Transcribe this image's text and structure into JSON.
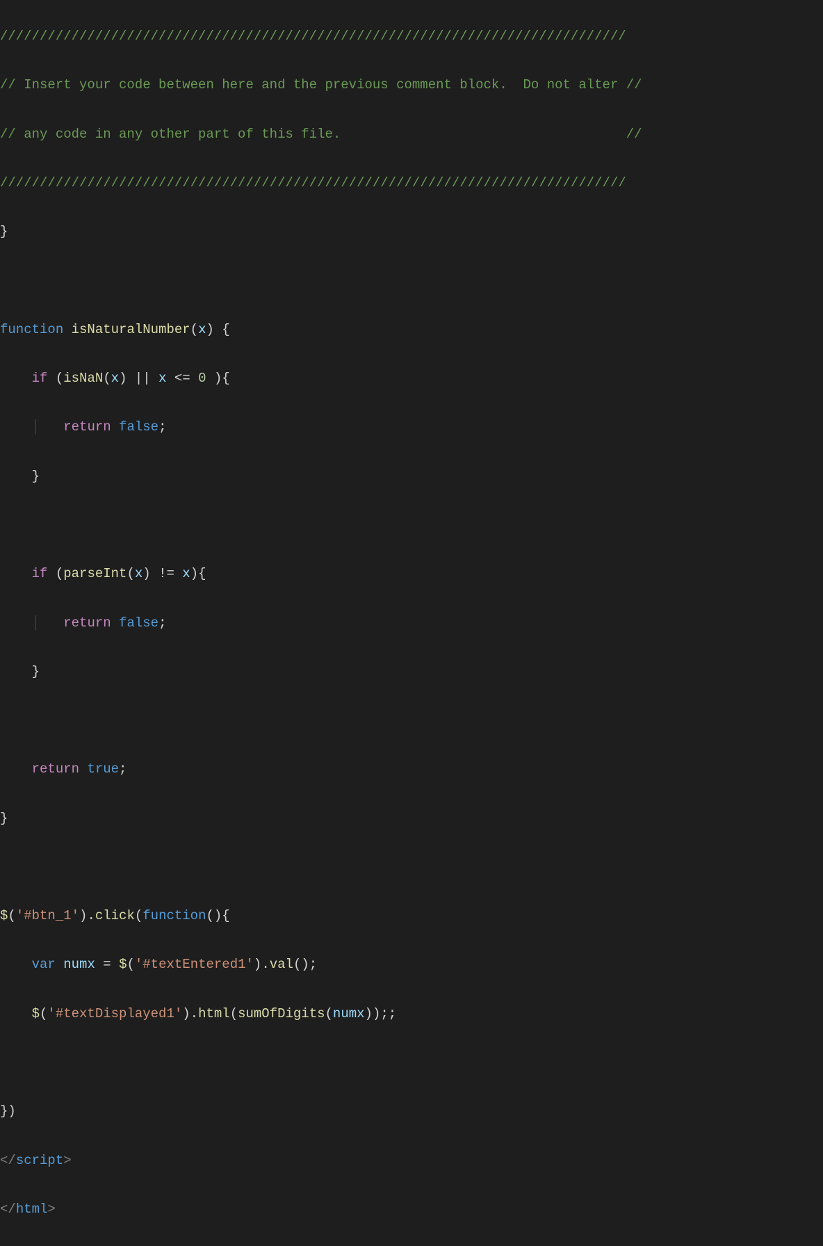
{
  "code": {
    "comment_bar": "///////////////////////////////////////////////////////////////////////////////",
    "comment_line1": "// Insert your code between here and the previous comment block.  Do not alter //",
    "comment_line2": "// any code in any other part of this file.                                    //",
    "fn1_name": "isNaturalNumber",
    "fn1_param": "x",
    "kw_function": "function",
    "kw_if": "if",
    "kw_return": "return",
    "kw_var": "var",
    "call_isNaN": "isNaN",
    "call_parseInt": "parseInt",
    "bool_false": "false",
    "bool_true": "true",
    "num_zero": "0",
    "op_or": "||",
    "op_le": "<=",
    "op_ne": "!=",
    "op_eq": "=",
    "jq": "$",
    "str_btn1": "'#btn_1'",
    "str_textEntered1": "'#textEntered1'",
    "str_textDisplayed1": "'#textDisplayed1'",
    "call_click": "click",
    "call_val": "val",
    "call_html": "html",
    "call_sumOfDigits": "sumOfDigits",
    "var_numx": "numx",
    "tag_script": "script",
    "tag_html": "html",
    "brace_open": "{",
    "brace_close": "}",
    "paren_open": "(",
    "paren_close": ")",
    "semi": ";",
    "dot": ".",
    "tagpunct_open": "</",
    "tagpunct_close": ">",
    "brace_paren_close": "})"
  }
}
